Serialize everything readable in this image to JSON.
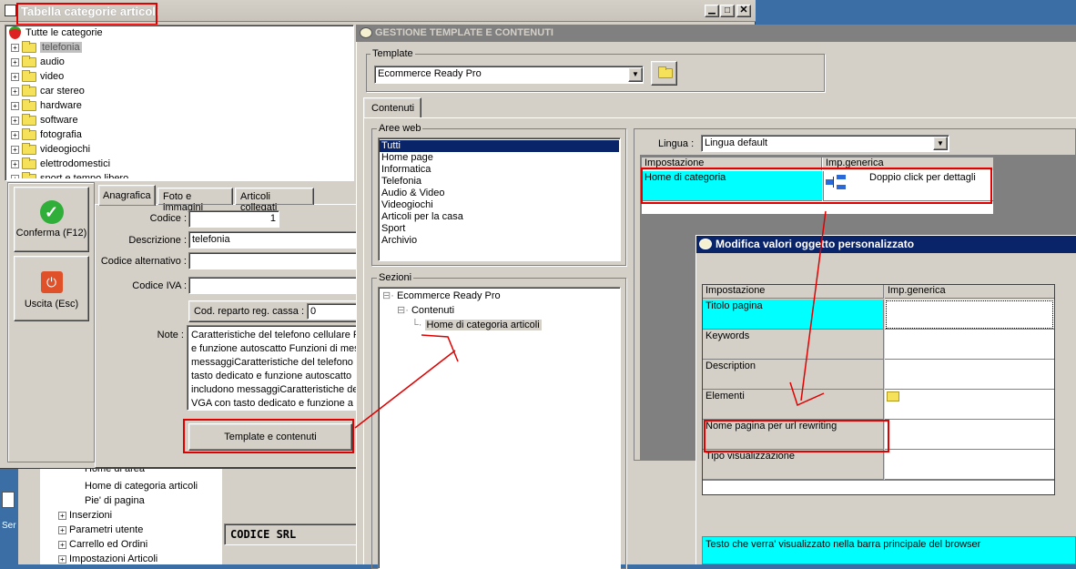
{
  "left_window": {
    "title": "Tabella categorie articoli",
    "tree_root": "Tutte le categorie",
    "categories": [
      "telefonia",
      "audio",
      "video",
      "car stereo",
      "hardware",
      "software",
      "fotografia",
      "videogiochi",
      "elettrodomestici",
      "sport e tempo libero"
    ],
    "confirm_label": "Conferma (F12)",
    "exit_label": "Uscita (Esc)",
    "tabs": [
      "Anagrafica",
      "Foto e immagini",
      "Articoli collegati"
    ],
    "fields": {
      "codice_label": "Codice :",
      "codice_value": "1",
      "descrizione_label": "Descrizione :",
      "descrizione_value": "telefonia",
      "codice_alt_label": "Codice alternativo :",
      "codice_iva_label": "Codice IVA :",
      "reparto_label": "Cod. reparto reg. cassa :",
      "reparto_value": "0",
      "note_label": "Note :",
      "note_lines": [
        "Caratteristiche del telefono cellulare F",
        "e funzione autoscatto Funzioni di mes",
        "messaggiCaratteristiche del telefono",
        "tasto dedicato e funzione autoscatto",
        "includono messaggiCaratteristiche de",
        "VGA con tasto dedicato e funzione a"
      ]
    },
    "template_button": "Template e contenuti"
  },
  "background": {
    "tree_items": [
      "Home di area",
      "Home di categoria articoli",
      "Pie' di pagina"
    ],
    "tree_groups": [
      "Inserzioni",
      "Parametri utente",
      "Carrello ed Ordini",
      "Impostazioni Articoli"
    ],
    "status": "CODICE SRL",
    "desktop_label": "Ser"
  },
  "template_window": {
    "title": "GESTIONE TEMPLATE E CONTENUTI",
    "template_group": "Template",
    "template_value": "Ecommerce Ready Pro",
    "tab": "Contenuti",
    "aree_title": "Aree web",
    "aree": [
      "Tutti",
      "Home page",
      "Informatica",
      "Telefonia",
      "Audio & Video",
      "Videogiochi",
      "Articoli per la casa",
      "Sport",
      "Archivio"
    ],
    "sezioni_title": "Sezioni",
    "sezioni_root": "Ecommerce Ready Pro",
    "sezioni_child": "Contenuti",
    "sezioni_leaf": "Home di categoria articoli",
    "lingua_label": "Lingua :",
    "lingua_value": "Lingua default",
    "grid_headers": [
      "Impostazione",
      "Imp.generica"
    ],
    "grid_row_name": "Home di categoria",
    "grid_row_value": "Doppio click per dettagli"
  },
  "modal": {
    "title": "Modifica valori oggetto personalizzato",
    "headers": [
      "Impostazione",
      "Imp.generica"
    ],
    "rows": [
      "Titolo pagina",
      "Keywords",
      "Description",
      "Elementi",
      "Nome pagina per url rewriting",
      "Tipo visualizzazione"
    ],
    "help_text": "Testo che verra' visualizzato nella barra principale del browser"
  },
  "colors": {
    "accent_cyan": "#00ffff",
    "annotation_red": "#e00000",
    "title_blue": "#0a246a",
    "desktop": "#3a6ea5"
  }
}
